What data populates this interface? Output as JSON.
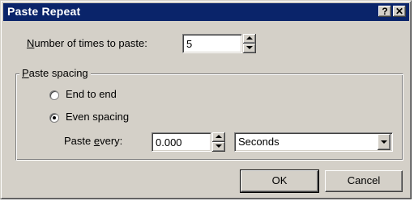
{
  "dialog": {
    "title": "Paste Repeat",
    "help_glyph": "?",
    "close_glyph": "✕"
  },
  "times": {
    "label_mnemonic": "N",
    "label_rest": "umber of times to paste:",
    "value": "5"
  },
  "spacing": {
    "group_mnemonic": "P",
    "group_rest": "aste spacing",
    "end_to_end_label": "End to end",
    "even_spacing_label": "Even spacing",
    "selected": "even_spacing",
    "paste_every_prefix": "Paste ",
    "paste_every_mnemonic": "e",
    "paste_every_suffix": "very:",
    "paste_every_value": "0.000",
    "unit_selected": "Seconds"
  },
  "buttons": {
    "ok": "OK",
    "cancel": "Cancel"
  }
}
